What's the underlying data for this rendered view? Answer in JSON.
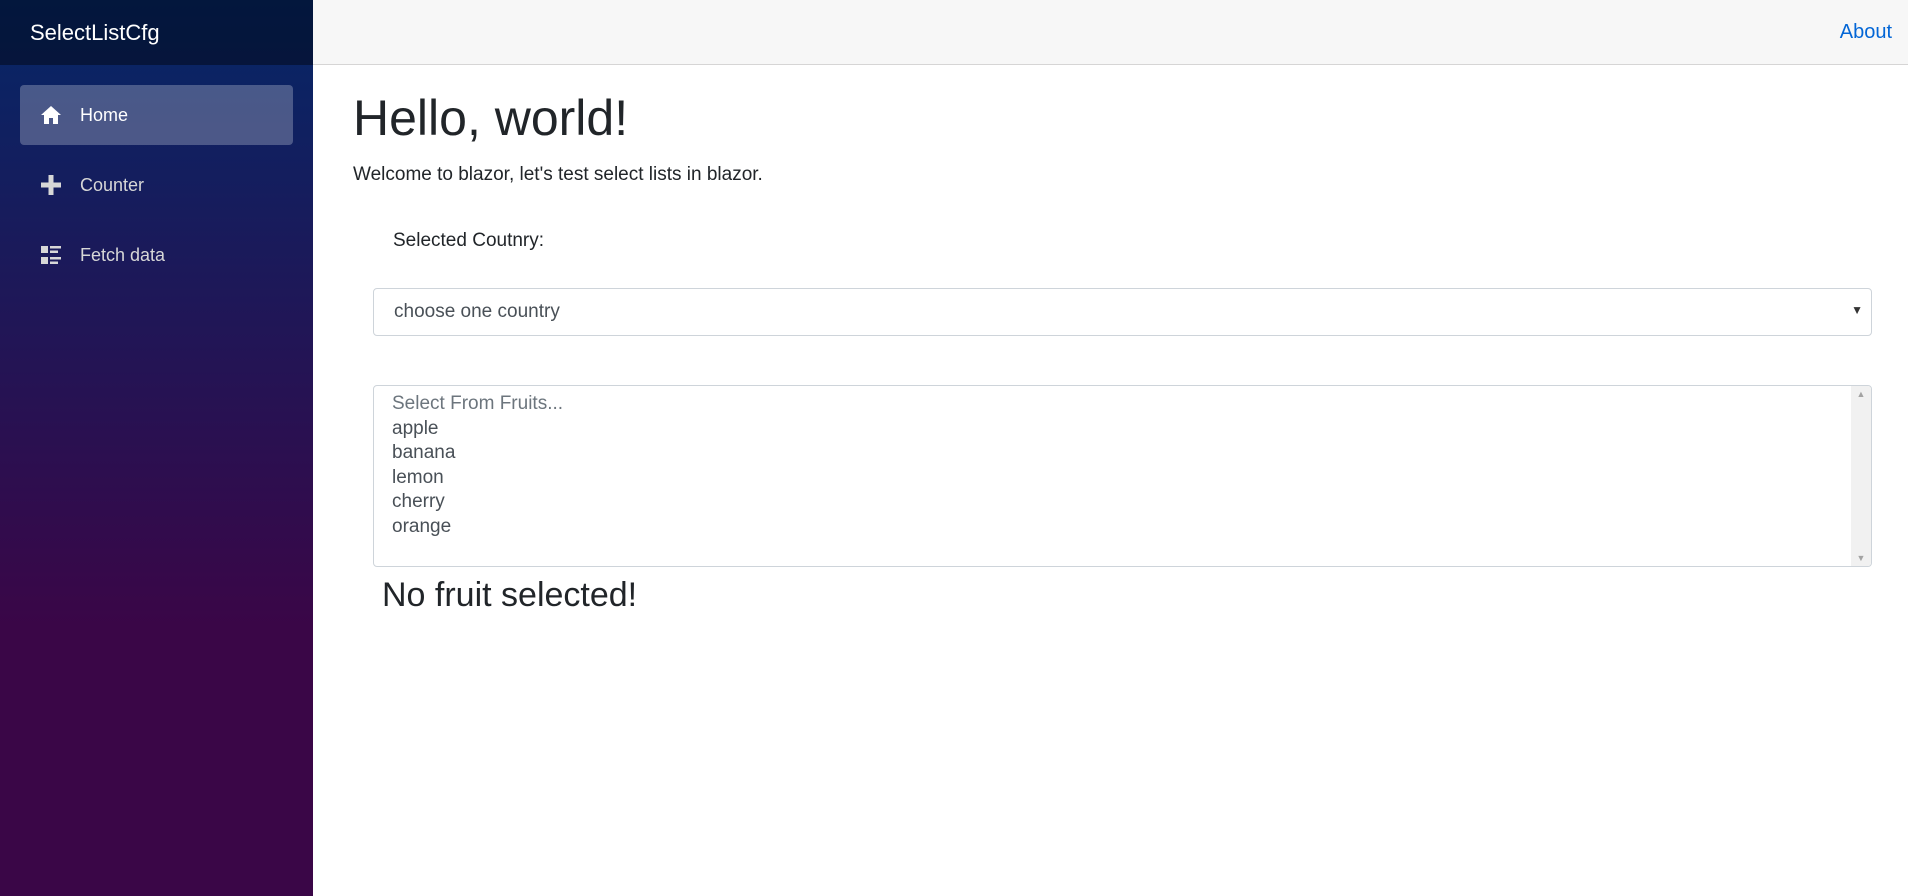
{
  "sidebar": {
    "brand": "SelectListCfg",
    "items": [
      {
        "label": "Home",
        "icon": "home-icon",
        "active": true
      },
      {
        "label": "Counter",
        "icon": "plus-icon",
        "active": false
      },
      {
        "label": "Fetch data",
        "icon": "list-rich-icon",
        "active": false
      }
    ]
  },
  "top_row": {
    "about_link": "About"
  },
  "main": {
    "title": "Hello, world!",
    "intro": "Welcome to blazor, let's test select lists in blazor.",
    "country_label": "Selected Coutnry:",
    "country_select": {
      "selected": "choose one country"
    },
    "fruit_list": {
      "options": [
        "Select From Fruits...",
        "apple",
        "banana",
        "lemon",
        "cherry",
        "orange"
      ]
    },
    "status_text": "No fruit selected!"
  },
  "colors": {
    "sidebar_top": "#052767",
    "sidebar_bottom": "#3a0647",
    "link": "#0366d6",
    "top_row_bg": "#f7f7f7"
  }
}
